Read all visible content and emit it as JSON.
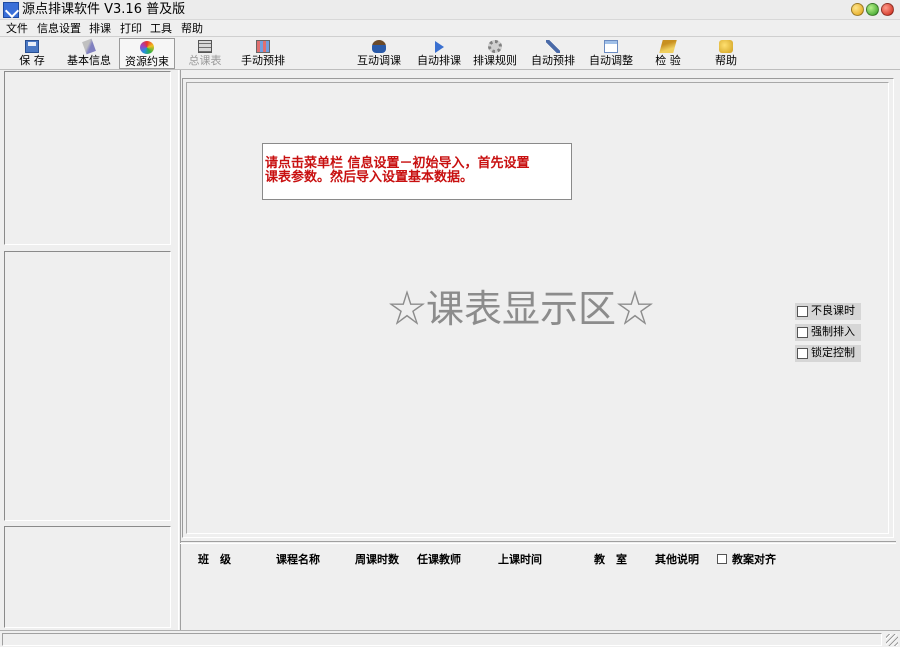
{
  "window": {
    "title": "源点排课软件 V3.16 普及版"
  },
  "menu": [
    "文件",
    "信息设置",
    "排课",
    "打印",
    "工具",
    "帮助"
  ],
  "toolbar": [
    {
      "label": "保  存",
      "icon": "save-icon"
    },
    {
      "label": "基本信息",
      "icon": "info-icon"
    },
    {
      "label": "资源约束",
      "icon": "resource-icon"
    },
    {
      "label": "总课表",
      "icon": "grid-icon"
    },
    {
      "label": "手动预排",
      "icon": "manual-icon"
    },
    {
      "label": "互动调课",
      "icon": "person-icon"
    },
    {
      "label": "自动排课",
      "icon": "play-icon"
    },
    {
      "label": "排课规则",
      "icon": "gear-icon"
    },
    {
      "label": "自动预排",
      "icon": "wrench-icon"
    },
    {
      "label": "自动调整",
      "icon": "document-icon"
    },
    {
      "label": "检  验",
      "icon": "check-icon"
    },
    {
      "label": "帮助",
      "icon": "help-icon"
    }
  ],
  "notice": {
    "line1": "请点击菜单栏 信息设置－初始导入，首先设置",
    "line2": "课表参数。然后导入设置基本数据。"
  },
  "display_label": "☆课表显示区☆",
  "side_options": [
    {
      "label": "不良课时",
      "checked": false
    },
    {
      "label": "强制排入",
      "checked": false
    },
    {
      "label": "锁定控制",
      "checked": false
    }
  ],
  "detail_columns": [
    "班　级",
    "课程名称",
    "周课时数",
    "任课教师",
    "上课时间",
    "教　室",
    "其他说明"
  ],
  "detail_checkbox": {
    "label": "教案对齐",
    "checked": false
  }
}
